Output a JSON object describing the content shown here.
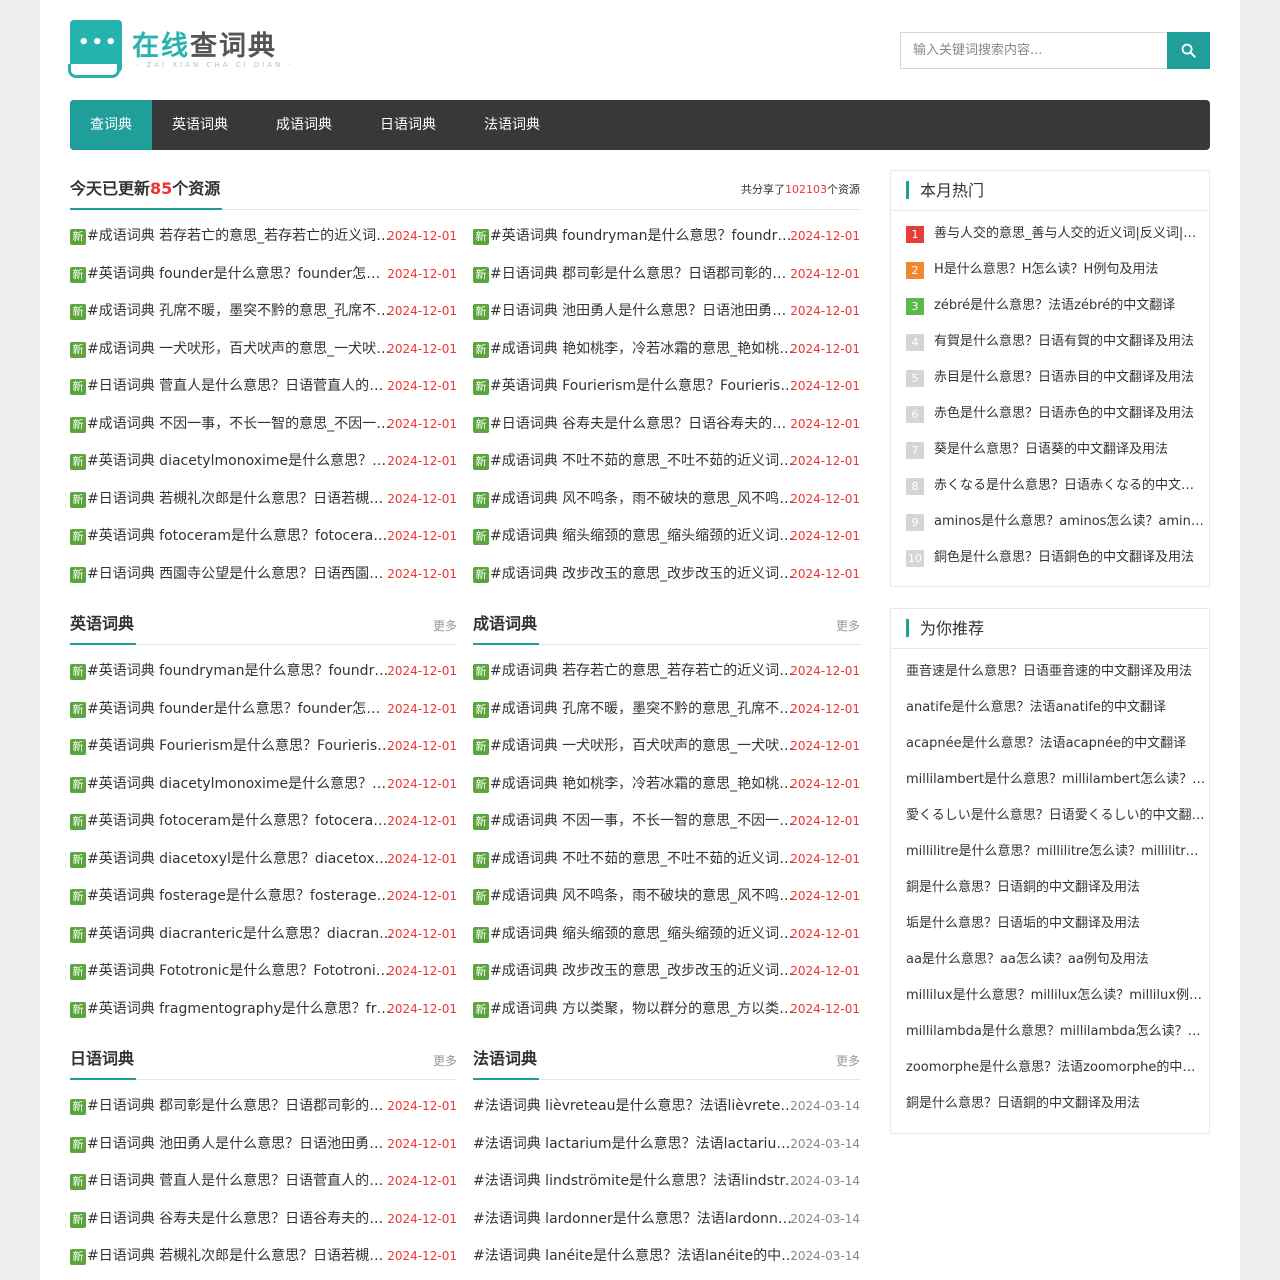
{
  "logo": {
    "title_main": "在线",
    "title_accent": "查词典",
    "subtitle": "· ZAI XIAN CHA CI DIAN ·",
    "dots": "•••"
  },
  "search": {
    "placeholder": "输入关键词搜索内容..."
  },
  "nav": [
    "查词典",
    "英语词典",
    "成语词典",
    "日语词典",
    "法语词典"
  ],
  "updated": {
    "title_prefix": "今天已更新",
    "count": "85",
    "title_suffix": "个资源",
    "shared_prefix": "共分享了",
    "shared_count": "102103",
    "shared_suffix": "个资源",
    "left": [
      {
        "text": "#成语词典 若存若亡的意思_若存若亡的近义词|反义词|例句",
        "date": "2024-12-01"
      },
      {
        "text": "#英语词典 founder是什么意思？founder怎么读？",
        "date": "2024-12-01"
      },
      {
        "text": "#成语词典 孔席不暖，墨突不黔的意思_孔席不暖，墨突不黔",
        "date": "2024-12-01"
      },
      {
        "text": "#成语词典 一犬吠形，百犬吠声的意思_一犬吠形，百犬吠声",
        "date": "2024-12-01"
      },
      {
        "text": "#日语词典 菅直人是什么意思？日语菅直人的中文翻译",
        "date": "2024-12-01"
      },
      {
        "text": "#成语词典 不因一事，不长一智的意思_不因一事，不长一智",
        "date": "2024-12-01"
      },
      {
        "text": "#英语词典 diacetylmonoxime是什么意思？diacetylmonoxime",
        "date": "2024-12-01"
      },
      {
        "text": "#日语词典 若槻礼次郎是什么意思？日语若槻礼次郎",
        "date": "2024-12-01"
      },
      {
        "text": "#英语词典 fotoceram是什么意思？fotoceram怎么读？",
        "date": "2024-12-01"
      },
      {
        "text": "#日语词典 西園寺公望是什么意思？日语西園寺公望",
        "date": "2024-12-01"
      }
    ],
    "right": [
      {
        "text": "#英语词典 foundryman是什么意思？foundryman怎么读？",
        "date": "2024-12-01"
      },
      {
        "text": "#日语词典 郡司彰是什么意思？日语郡司彰的中文翻译",
        "date": "2024-12-01"
      },
      {
        "text": "#日语词典 池田勇人是什么意思？日语池田勇人的中文翻译",
        "date": "2024-12-01"
      },
      {
        "text": "#成语词典 艳如桃李，冷若冰霜的意思_艳如桃李，冷若冰霜",
        "date": "2024-12-01"
      },
      {
        "text": "#英语词典 Fourierism是什么意思？Fourierism怎么读？",
        "date": "2024-12-01"
      },
      {
        "text": "#日语词典 谷寿夫是什么意思？日语谷寿夫的中文翻译",
        "date": "2024-12-01"
      },
      {
        "text": "#成语词典 不吐不茹的意思_不吐不茹的近义词|反义词|例句",
        "date": "2024-12-01"
      },
      {
        "text": "#成语词典 风不鸣条，雨不破块的意思_风不鸣条，雨不破块",
        "date": "2024-12-01"
      },
      {
        "text": "#成语词典 缩头缩颈的意思_缩头缩颈的近义词|反义词|例句",
        "date": "2024-12-01"
      },
      {
        "text": "#成语词典 改步改玉的意思_改步改玉的近义词|反义词|例句",
        "date": "2024-12-01"
      }
    ]
  },
  "english": {
    "title": "英语词典",
    "more": "更多",
    "items": [
      {
        "text": "#英语词典 foundryman是什么意思？foundryman怎么读？",
        "date": "2024-12-01"
      },
      {
        "text": "#英语词典 founder是什么意思？founder怎么读？",
        "date": "2024-12-01"
      },
      {
        "text": "#英语词典 Fourierism是什么意思？Fourierism怎么读？",
        "date": "2024-12-01"
      },
      {
        "text": "#英语词典 diacetylmonoxime是什么意思？diacetylmonoxime",
        "date": "2024-12-01"
      },
      {
        "text": "#英语词典 fotoceram是什么意思？fotoceram怎么读？",
        "date": "2024-12-01"
      },
      {
        "text": "#英语词典 diacetoxyl是什么意思？diacetoxyl怎么读？",
        "date": "2024-12-01"
      },
      {
        "text": "#英语词典 fosterage是什么意思？fosterage怎么读？",
        "date": "2024-12-01"
      },
      {
        "text": "#英语词典 diacranteric是什么意思？diacranteric怎么读？",
        "date": "2024-12-01"
      },
      {
        "text": "#英语词典 Fototronic是什么意思？Fototronic怎么读？",
        "date": "2024-12-01"
      },
      {
        "text": "#英语词典 fragmentography是什么意思？fragmentography",
        "date": "2024-12-01"
      }
    ]
  },
  "idiom": {
    "title": "成语词典",
    "more": "更多",
    "items": [
      {
        "text": "#成语词典 若存若亡的意思_若存若亡的近义词|反义词|例句",
        "date": "2024-12-01"
      },
      {
        "text": "#成语词典 孔席不暖，墨突不黔的意思_孔席不暖，墨突不黔",
        "date": "2024-12-01"
      },
      {
        "text": "#成语词典 一犬吠形，百犬吠声的意思_一犬吠形，百犬吠声",
        "date": "2024-12-01"
      },
      {
        "text": "#成语词典 艳如桃李，冷若冰霜的意思_艳如桃李，冷若冰霜",
        "date": "2024-12-01"
      },
      {
        "text": "#成语词典 不因一事，不长一智的意思_不因一事，不长一智",
        "date": "2024-12-01"
      },
      {
        "text": "#成语词典 不吐不茹的意思_不吐不茹的近义词|反义词|例句",
        "date": "2024-12-01"
      },
      {
        "text": "#成语词典 风不鸣条，雨不破块的意思_风不鸣条，雨不破块",
        "date": "2024-12-01"
      },
      {
        "text": "#成语词典 缩头缩颈的意思_缩头缩颈的近义词|反义词|例句",
        "date": "2024-12-01"
      },
      {
        "text": "#成语词典 改步改玉的意思_改步改玉的近义词|反义词|例句",
        "date": "2024-12-01"
      },
      {
        "text": "#成语词典 方以类聚，物以群分的意思_方以类聚，物以群分",
        "date": "2024-12-01"
      }
    ]
  },
  "japanese": {
    "title": "日语词典",
    "more": "更多",
    "items": [
      {
        "text": "#日语词典 郡司彰是什么意思？日语郡司彰的中文翻译",
        "date": "2024-12-01"
      },
      {
        "text": "#日语词典 池田勇人是什么意思？日语池田勇人的中文翻译",
        "date": "2024-12-01"
      },
      {
        "text": "#日语词典 菅直人是什么意思？日语菅直人的中文翻译",
        "date": "2024-12-01"
      },
      {
        "text": "#日语词典 谷寿夫是什么意思？日语谷寿夫的中文翻译",
        "date": "2024-12-01"
      },
      {
        "text": "#日语词典 若槻礼次郎是什么意思？日语若槻礼次郎",
        "date": "2024-12-01"
      }
    ]
  },
  "french": {
    "title": "法语词典",
    "more": "更多",
    "items": [
      {
        "text": "#法语词典 lièvreteau是什么意思？法语lièvreteau的中文翻译",
        "date": "2024-03-14"
      },
      {
        "text": "#法语词典 lactarium是什么意思？法语lactarium的中文翻译",
        "date": "2024-03-14"
      },
      {
        "text": "#法语词典 lindströmite是什么意思？法语lindströmite的中文翻译",
        "date": "2024-03-14"
      },
      {
        "text": "#法语词典 lardonner是什么意思？法语lardonner的中文翻译",
        "date": "2024-03-14"
      },
      {
        "text": "#法语词典 lanéite是什么意思？法语lanéite的中文翻译",
        "date": "2024-03-14"
      }
    ]
  },
  "hot": {
    "title": "本月热门",
    "items": [
      "善与人交的意思_善与人交的近义词|反义词|例句",
      "H是什么意思？H怎么读？H例句及用法",
      "zébré是什么意思？法语zébré的中文翻译",
      "有賀是什么意思？日语有賀的中文翻译及用法",
      "赤目是什么意思？日语赤目的中文翻译及用法",
      "赤色是什么意思？日语赤色的中文翻译及用法",
      "葵是什么意思？日语葵的中文翻译及用法",
      "赤くなる是什么意思？日语赤くなる的中文翻译及用法",
      "aminos是什么意思？aminos怎么读？aminos例句及用法",
      "銅色是什么意思？日语銅色的中文翻译及用法"
    ]
  },
  "recommend": {
    "title": "为你推荐",
    "items": [
      "亜音速是什么意思？日语亜音速的中文翻译及用法",
      "anatife是什么意思？法语anatife的中文翻译",
      "acapnée是什么意思？法语acapnée的中文翻译",
      "millilambert是什么意思？millilambert怎么读？millilambert例句及用法",
      "愛くるしい是什么意思？日语愛くるしい的中文翻译及用法",
      "millilitre是什么意思？millilitre怎么读？millilitre例句及用法",
      "銅是什么意思？日语銅的中文翻译及用法",
      "垢是什么意思？日语垢的中文翻译及用法",
      "aa是什么意思？aa怎么读？aa例句及用法",
      "millilux是什么意思？millilux怎么读？millilux例句及用法",
      "millilambda是什么意思？millilambda怎么读？millilambda例句及用法",
      "zoomorphe是什么意思？法语zoomorphe的中文翻译",
      "銅是什么意思？日语銅的中文翻译及用法"
    ]
  },
  "badge_new": "新",
  "colors": {
    "accent": "#1f9e9a",
    "nav_bg": "#383838",
    "date_red": "#ee3333",
    "badge_green": "#5aa53c"
  }
}
